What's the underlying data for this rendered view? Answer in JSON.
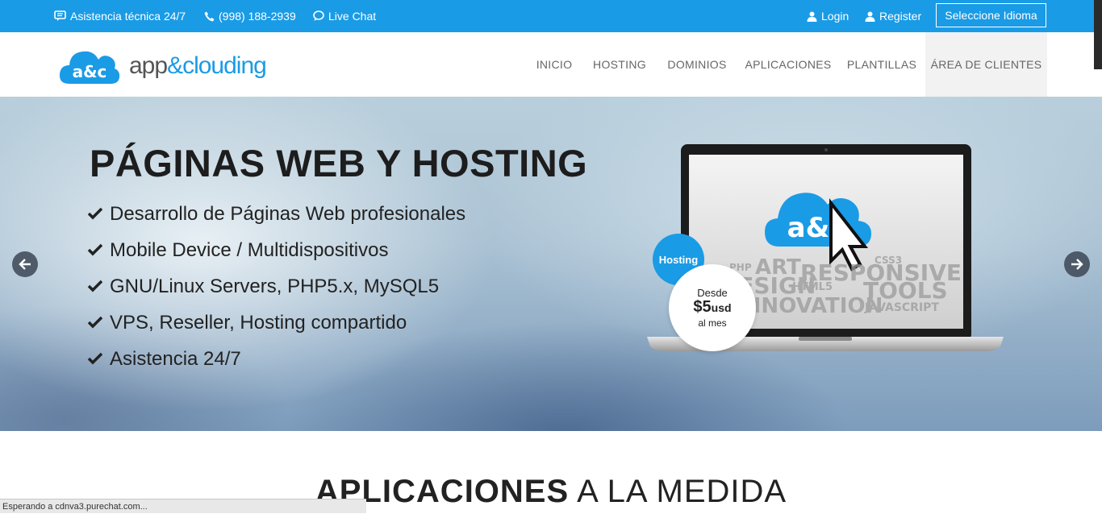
{
  "topbar": {
    "support": "Asistencia técnica 24/7",
    "phone": "(998) 188-2939",
    "chat": "Live Chat",
    "login": "Login",
    "register": "Register",
    "language": "Seleccione Idioma"
  },
  "brand": {
    "name_a": "app",
    "name_b": "&clouding",
    "mark": "a&c"
  },
  "nav": {
    "items": [
      "INICIO",
      "HOSTING",
      "DOMINIOS",
      "APLICACIONES",
      "PLANTILLAS",
      "ÁREA DE CLIENTES"
    ],
    "active": "ÁREA DE CLIENTES"
  },
  "hero": {
    "title": "PÁGINAS WEB Y HOSTING",
    "features": [
      "Desarrollo de Páginas Web profesionales",
      "Mobile Device / Multidispositivos",
      "GNU/Linux Servers, PHP5.x, MySQL5",
      "VPS, Reseller, Hosting compartido",
      "Asistencia 24/7"
    ],
    "screen_words": [
      "PHP",
      "ART",
      "RESPONSIVE",
      "CSS3",
      "DESIGN",
      "HTML5",
      "TOOLS",
      "INNOVATION",
      "JAVASCRIPT"
    ],
    "badge": {
      "label": "Hosting",
      "from": "Desde",
      "price": "$5",
      "currency": "usd",
      "period": "al mes"
    }
  },
  "section": {
    "title_bold": "APLICACIONES",
    "title_rest": " A LA MEDIDA"
  },
  "status_bar": "Esperando a cdnva3.purechat.com...",
  "colors": {
    "brand_blue": "#1a9be6",
    "topbar_bg": "#1a9be6",
    "nav_text": "#666666",
    "title": "#1d1d1d"
  }
}
